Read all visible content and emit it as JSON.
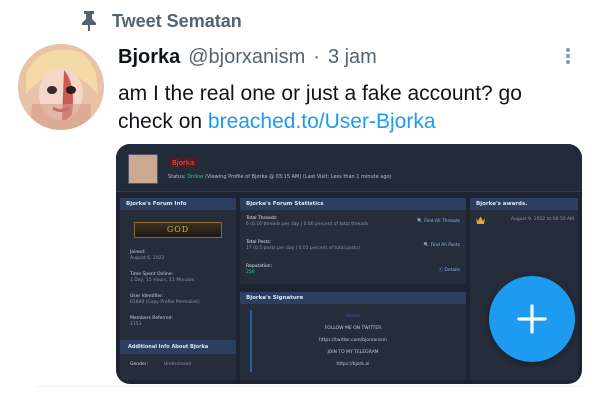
{
  "pinned": {
    "label": "Tweet Sematan"
  },
  "tweet": {
    "author_name": "Bjorka",
    "author_handle": "@bjorxanism",
    "separator": "·",
    "time": "3 jam",
    "text_before": "am I the real one or just a fake account? go check on ",
    "link_text": "breached.to/User-Bjorka"
  },
  "screenshot": {
    "profile_name": "Bjorka",
    "status_prefix": "Status:",
    "status_online": "Online",
    "status_rest": "(Viewing Profile of Bjorka @ 03:15 AM) (Last Visit: Less than 1 minute ago)",
    "left_panel": {
      "title": "Bjorka's Forum Info",
      "rank_text": "GOD",
      "joined_label": "Joined:",
      "joined_value": "August 6, 2022",
      "time_online_label": "Time Spent Online:",
      "time_online_value": "1 Day, 15 Hours, 11 Minutes",
      "uid_label": "User Identifier:",
      "uid_value": "61644 (Copy Profile Permalink)",
      "referred_label": "Members Referred:",
      "referred_value": "1153",
      "additional_title": "Additional Info About Bjorka",
      "gender_label": "Gender:",
      "gender_value": "Undisclosed"
    },
    "stats_panel": {
      "title": "Bjorka's Forum Statistics",
      "threads_label": "Total Threads:",
      "threads_value": "6 (0.16 threads per day | 0.00 percent of total threads",
      "threads_link": "Find All Threads",
      "posts_label": "Total Posts:",
      "posts_value": "17 (0.5 posts per day | 0.01 percent of total posts)",
      "posts_link": "Find All Posts",
      "reputation_label": "Reputation:",
      "reputation_value": "256",
      "reputation_link": "Details"
    },
    "signature_panel": {
      "title": "Bjorka's Signature",
      "lines": [
        "Bjorka",
        "FOLLOW ME ON TWITTER",
        "https://twitter.com/bjorxanism",
        "JOIN TO MY TELEGRAM",
        "https://bjork.ai"
      ]
    },
    "awards_panel": {
      "title": "Bjorka's awards.",
      "award_date": "August 9, 2022 at 08:50 AM"
    }
  },
  "colors": {
    "accent": "#1d9bf0",
    "text": "#0f1419",
    "muted": "#536471",
    "forum_bg": "#1d2330",
    "forum_header": "#2c3f61"
  },
  "icons": [
    "pin-icon",
    "more-icon",
    "crown-icon",
    "search-icon",
    "info-icon",
    "plus-icon"
  ]
}
